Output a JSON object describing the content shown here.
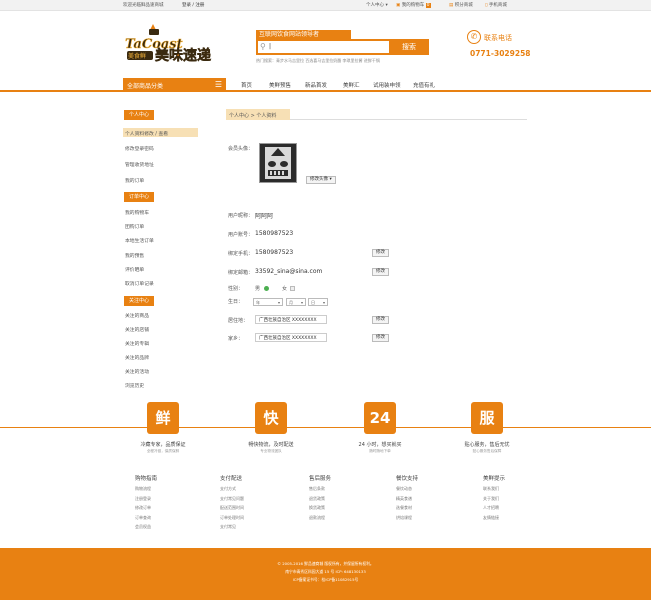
{
  "topbar": {
    "welcome": "欢迎光临鲜品速商城",
    "login": "登录 / 注册",
    "user_center": "个人中心",
    "cart": "我的购物车",
    "cart_count": "0",
    "points_mall": "积分商城",
    "mobile_mall": "手机商城"
  },
  "header": {
    "logo_text_en": "TaCoast",
    "logo_text_cn": "美味速递",
    "search_title": "互联网饮食网站领导者",
    "search_value": "|",
    "search_button": "搜索",
    "hot_search": "热门搜索：青步水马吉里拉  百选喜马吉里拉奶酪  李琪里拉酱  进鲜干锅",
    "phone_label": "联系电话",
    "phone_number": "0771-3029258"
  },
  "nav": {
    "category_label": "全部商品分类",
    "links": [
      "首页",
      "美鲜预售",
      "新品首发",
      "美鲜汇",
      "试用装申领",
      "充值有礼"
    ]
  },
  "sidebar": {
    "sections": [
      {
        "title": "个人中心",
        "items": [
          "个人资料修改 / 查看",
          "修改登录密码",
          "管理收货地址",
          "我的订单"
        ]
      },
      {
        "title": "订单中心",
        "items": [
          "我的购物车",
          "团购订单",
          "本地生活订单",
          "我的预售",
          "评价晒单",
          "取消订单记录"
        ]
      },
      {
        "title": "关注中心",
        "items": [
          "关注的商品",
          "关注的店铺",
          "关注的专辑",
          "关注的品牌",
          "关注的活动",
          "浏览历史"
        ]
      }
    ]
  },
  "main": {
    "breadcrumb": "个人中心 > 个人资料",
    "avatar_label": "会员头像：",
    "avatar_button": "修改头像",
    "nickname_label": "用户昵称：",
    "nickname": "阿阿阿",
    "account_label": "用户账号：",
    "account": "1580987523",
    "mobile_label": "绑定手机：",
    "mobile": "1580987523",
    "email_label": "绑定邮箱：",
    "email": "33592_sina@sina.com",
    "modify": "修改",
    "gender_label": "性别：",
    "gender_male": "男",
    "gender_female": "女",
    "birthday_label": "生日：",
    "birth_year": "年",
    "birth_month": "月",
    "birth_day": "日",
    "residence_label": "居住地：",
    "residence": "广西壮族自治区 XXXXXXXX",
    "hometown_label": "家乡：",
    "hometown": "广西壮族自治区 XXXXXXXX"
  },
  "features": [
    {
      "icon": "鲜",
      "title": "冷藏专家，品质保证",
      "sub": "全程冷链，保质保鲜"
    },
    {
      "icon": "快",
      "title": "畅快物流，及时配送",
      "sub": "专业物流团队"
    },
    {
      "icon": "24",
      "title": "24 小时，想买就买",
      "sub": "随时随地下单"
    },
    {
      "icon": "服",
      "title": "贴心服务，售后无忧",
      "sub": "贴心服务售后保障"
    }
  ],
  "footer_cols": [
    {
      "title": "购物指南",
      "items": [
        "购物流程",
        "注册登录",
        "修改订单",
        "订单查询",
        "会员权益"
      ]
    },
    {
      "title": "支付配送",
      "items": [
        "支付方式",
        "支付常见问题",
        "配送范围时间",
        "订单处理时间",
        "支付常见"
      ]
    },
    {
      "title": "售后服务",
      "items": [
        "售后条款",
        "退货政策",
        "换货政策",
        "退款流程"
      ]
    },
    {
      "title": "餐饮支持",
      "items": [
        "餐饮动态",
        "精英食谱",
        "选餐食材",
        "烘焙课程"
      ]
    },
    {
      "title": "美鲜提示",
      "items": [
        "联系我们",
        "关于我们",
        "人才招聘",
        "友情链接"
      ]
    }
  ],
  "footer": {
    "line1": "© 2005-2016 鲜品速商城 版权所有，并保留所有权利。",
    "line2": "南宁市青秀区科园大道 15 号   ICP: 648130133",
    "line3": "ICP备案证书号：桂ICP备11082915号"
  },
  "colors": {
    "brand": "#e88112",
    "light": "#f7e0b5"
  }
}
